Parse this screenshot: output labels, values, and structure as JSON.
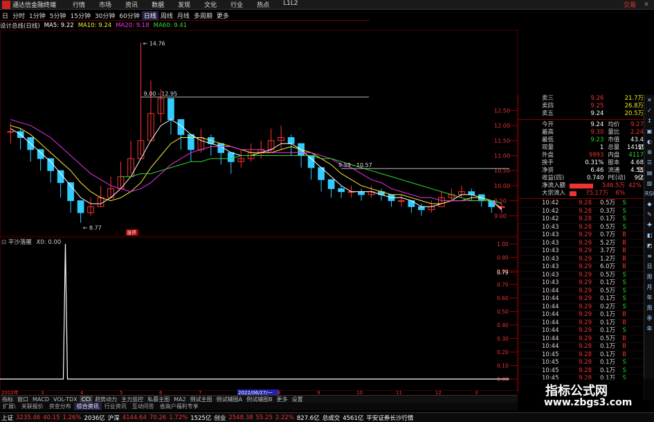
{
  "title_bar": {
    "app_name": "通达信金融终端",
    "menus": [
      "行情",
      "市场",
      "资讯",
      "数据",
      "发现",
      "文化",
      "行业",
      "热点",
      "L1L2"
    ],
    "trade_label": "交易"
  },
  "toolbar": {
    "items": [
      "日",
      "分时",
      "1分钟",
      "5分钟",
      "15分钟",
      "30分钟",
      "60分钟",
      "日线",
      "周线",
      "月线",
      "多周期",
      "更多"
    ],
    "active_index": 7
  },
  "ma_legend": {
    "name": "设计总线(日线)",
    "ma5": "MA5: 9.22",
    "ma10": "MA10: 9.24",
    "ma20": "MA20: 9.18",
    "ma60": "MA60: 9.41"
  },
  "colors": {
    "up": "#ff3333",
    "down": "#33ccff",
    "ma5": "#ffffff",
    "ma10": "#ffee33",
    "ma20": "#ee33ee",
    "ma60": "#33dd33",
    "bg": "#000000",
    "frame": "#880000"
  },
  "price_annotations": {
    "high": "14.76",
    "low": "8.77",
    "range1": "9.00 - 12.95",
    "range2": "9.59 - 10.57",
    "marker1": "涨停"
  },
  "price_axis": [
    "12.50",
    "12.00",
    "11.50",
    "11.00",
    "10.50",
    "10.00",
    "9.50",
    "9.00"
  ],
  "indicator": {
    "name": "平沙落雁",
    "value": "X0: 0.00",
    "axis": [
      "1.00",
      "0.90",
      "0.80",
      "0.79",
      "0.70",
      "0.60",
      "0.50",
      "0.40",
      "0.30",
      "0.20",
      "0.10",
      "0.00"
    ]
  },
  "date_axis": [
    "2022年",
    "3",
    "4",
    "5",
    "6",
    "7",
    "2022/06/27/一",
    "8",
    "9",
    "10",
    "11",
    "12",
    "3"
  ],
  "bottom_tabs": [
    "指标",
    "窗口",
    "MACD",
    "VOL-TDX",
    "CCI",
    "趋势动力",
    "主力监控",
    "私募主图",
    "MA2",
    "例试主图",
    "例试辅图A",
    "例试辅图B",
    "更多",
    "设置"
  ],
  "bottom_tabs_active": 4,
  "bottom_tabs2": [
    "扩展\\",
    "关联报价",
    "资金分布",
    "综合资讯",
    "行业资讯",
    "互动问答",
    "省商户福利专享"
  ],
  "bottom_tabs2_active": 3,
  "quote": {
    "rows": [
      {
        "l1": "卖三",
        "v1": "9.26",
        "c1": "red",
        "v1b": "21.7万",
        "c1b": "yellow"
      },
      {
        "l1": "卖四",
        "v1": "9.25",
        "c1": "red",
        "v1b": "26.8万",
        "c1b": "yellow"
      },
      {
        "l1": "卖五",
        "v1": "9.24",
        "c1": "white",
        "v1b": "20.5万",
        "c1b": "yellow"
      }
    ],
    "stats": [
      {
        "l1": "今开",
        "v1": "9.24",
        "c1": "white",
        "l2": "均价",
        "v2": "9.27",
        "c2": "red"
      },
      {
        "l1": "最高",
        "v1": "9.30",
        "c1": "red",
        "l2": "量比",
        "v2": "2.24",
        "c2": "red"
      },
      {
        "l1": "最低",
        "v1": "9.23",
        "c1": "green",
        "l2": "市值",
        "v2": "43.4亿",
        "c2": "white"
      },
      {
        "l1": "现量",
        "v1": "1",
        "c1": "white",
        "l2": "总量",
        "v2": "14110",
        "c2": "white"
      },
      {
        "l1": "外盘",
        "v1": "9993",
        "c1": "red",
        "l2": "内盘",
        "v2": "4117",
        "c2": "green"
      },
      {
        "l1": "换手",
        "v1": "0.31%",
        "c1": "white",
        "l2": "股本",
        "v2": "4.68亿",
        "c2": "white"
      },
      {
        "l1": "净资",
        "v1": "6.46",
        "c1": "white",
        "l2": "流通",
        "v2": "4.55亿",
        "c2": "white"
      },
      {
        "l1": "收益(四)",
        "v1": "0.740",
        "c1": "white",
        "l2": "PE(动)",
        "v2": "9.7",
        "c2": "white"
      }
    ],
    "flow": [
      {
        "l": "净流入额",
        "v": "546.5万",
        "p": "42%"
      },
      {
        "l": "大宗流入",
        "v": "75.17万",
        "p": "6%"
      }
    ]
  },
  "ticks": [
    {
      "t": "10:42",
      "p": "9.28",
      "v": "0.5万",
      "s": "S"
    },
    {
      "t": "10:42",
      "p": "9.28",
      "v": "0.3万",
      "s": "S"
    },
    {
      "t": "10:42",
      "p": "9.28",
      "v": "0.1万",
      "s": "S"
    },
    {
      "t": "10:43",
      "p": "9.28",
      "v": "0.5万",
      "s": "S"
    },
    {
      "t": "10:43",
      "p": "9.29",
      "v": "0.7万",
      "s": "B"
    },
    {
      "t": "10:43",
      "p": "9.29",
      "v": "5.2万",
      "s": "B"
    },
    {
      "t": "10:43",
      "p": "9.29",
      "v": "3.7万",
      "s": "B"
    },
    {
      "t": "10:43",
      "p": "9.29",
      "v": "1.2万",
      "s": "B"
    },
    {
      "t": "10:43",
      "p": "9.29",
      "v": "6.0万",
      "s": "B"
    },
    {
      "t": "10:43",
      "p": "9.29",
      "v": "0.5万",
      "s": "S"
    },
    {
      "t": "10:43",
      "p": "9.29",
      "v": "0.1万",
      "s": "S"
    },
    {
      "t": "10:44",
      "p": "9.29",
      "v": "0.5万",
      "s": "S"
    },
    {
      "t": "10:44",
      "p": "9.29",
      "v": "0.1万",
      "s": "S"
    },
    {
      "t": "10:44",
      "p": "9.29",
      "v": "0.2万",
      "s": "S"
    },
    {
      "t": "10:44",
      "p": "9.29",
      "v": "0.1万",
      "s": "B"
    },
    {
      "t": "10:44",
      "p": "9.29",
      "v": "0.1万",
      "s": "B"
    },
    {
      "t": "10:44",
      "p": "9.29",
      "v": "0.1万",
      "s": "S"
    },
    {
      "t": "10:44",
      "p": "9.29",
      "v": "0.5万",
      "s": "B"
    },
    {
      "t": "10:44",
      "p": "9.28",
      "v": "0.1万",
      "s": "B"
    },
    {
      "t": "10:45",
      "p": "9.28",
      "v": "0.1万",
      "s": "B"
    },
    {
      "t": "10:45",
      "p": "9.28",
      "v": "0.1万",
      "s": "S"
    },
    {
      "t": "10:45",
      "p": "9.28",
      "v": "0.1万",
      "s": "S"
    },
    {
      "t": "10:45",
      "p": "9.28",
      "v": "0.1万",
      "s": "S"
    }
  ],
  "side_strip": [
    "✕",
    "✓",
    "↕",
    "▣",
    "◐",
    "⊞",
    "☰",
    "▤",
    "▥",
    "RSI",
    "◆",
    "✎",
    "✚",
    "◧",
    "◩",
    "≡",
    "日",
    "周",
    "月",
    "年",
    "周",
    "季",
    "年"
  ],
  "status_bar": {
    "items": [
      {
        "label": "上证",
        "value": "3235.46",
        "change": "40.15",
        "pct": "1.26%",
        "amount": "2036亿"
      },
      {
        "label": "沪深",
        "value": "4144.64",
        "change": "70.26",
        "pct": "1.72%",
        "amount": "1525亿"
      },
      {
        "label": "创业",
        "value": "2548.38",
        "change": "55.25",
        "pct": "2.22%",
        "amount": "827.6亿"
      }
    ],
    "total_label": "总成交",
    "total_value": "4561亿",
    "news": "平安证券长沙行情"
  },
  "watermark": {
    "title": "指标公式网",
    "url": "www.zbgs3.com"
  },
  "chart_data": {
    "type": "candlestick",
    "title": "设计总线(日线)",
    "xlabel": "",
    "ylabel": "",
    "ylim": [
      8.5,
      15.0
    ],
    "x": [
      "2022-01-04",
      "2022-01-11",
      "2022-01-18",
      "2022-01-25",
      "2022-02-08",
      "2022-02-15",
      "2022-02-22",
      "2022-03-01",
      "2022-03-08",
      "2022-03-15",
      "2022-03-22",
      "2022-03-29",
      "2022-04-06",
      "2022-04-13",
      "2022-04-20",
      "2022-04-27",
      "2022-05-06",
      "2022-05-13",
      "2022-05-20",
      "2022-05-27",
      "2022-06-03",
      "2022-06-10",
      "2022-06-17",
      "2022-06-27",
      "2022-07-04",
      "2022-07-11",
      "2022-07-18",
      "2022-07-25",
      "2022-08-01",
      "2022-08-08",
      "2022-08-15",
      "2022-08-22",
      "2022-08-29",
      "2022-09-05",
      "2022-09-13",
      "2022-09-20",
      "2022-09-27",
      "2022-10-10",
      "2022-10-17",
      "2022-10-24",
      "2022-10-31",
      "2022-11-07",
      "2022-11-14",
      "2022-11-21",
      "2022-11-28",
      "2022-12-05",
      "2022-12-12",
      "2022-12-19",
      "2022-12-26",
      "2023-01-03"
    ],
    "series": [
      {
        "name": "K",
        "close": [
          11.8,
          11.6,
          11.2,
          10.9,
          10.5,
          10.1,
          9.5,
          9.1,
          9.3,
          9.6,
          9.9,
          10.3,
          10.9,
          11.5,
          12.4,
          12.9,
          12.2,
          11.7,
          11.2,
          11.6,
          11.4,
          11.1,
          10.8,
          10.9,
          11.1,
          11.2,
          11.5,
          11.6,
          11.4,
          11.0,
          10.6,
          10.2,
          9.9,
          9.8,
          9.8,
          9.7,
          9.8,
          9.7,
          9.5,
          9.5,
          9.3,
          9.2,
          9.3,
          9.6,
          9.7,
          9.8,
          9.7,
          9.5,
          9.3,
          9.3
        ],
        "high": [
          12.1,
          11.9,
          11.5,
          11.2,
          10.8,
          10.4,
          9.8,
          9.3,
          9.6,
          10.0,
          10.3,
          10.8,
          11.5,
          14.76,
          13.5,
          13.2,
          12.6,
          12.0,
          11.6,
          11.9,
          11.7,
          11.4,
          11.1,
          11.2,
          11.4,
          11.5,
          11.9,
          12.0,
          11.7,
          11.3,
          10.9,
          10.5,
          10.1,
          10.0,
          10.0,
          9.9,
          10.0,
          9.9,
          9.7,
          9.7,
          9.5,
          9.4,
          9.5,
          9.8,
          9.9,
          10.0,
          9.9,
          9.7,
          9.5,
          9.4
        ],
        "low": [
          11.4,
          11.2,
          10.8,
          10.5,
          10.1,
          9.6,
          9.1,
          8.77,
          9.0,
          9.3,
          9.6,
          9.9,
          10.4,
          11.0,
          11.6,
          12.1,
          11.7,
          11.2,
          10.8,
          11.1,
          11.0,
          10.7,
          10.4,
          10.6,
          10.8,
          10.9,
          11.1,
          11.2,
          11.0,
          10.6,
          10.2,
          9.8,
          9.6,
          9.59,
          9.6,
          9.5,
          9.6,
          9.5,
          9.3,
          9.3,
          9.1,
          9.0,
          9.1,
          9.4,
          9.5,
          9.6,
          9.5,
          9.3,
          9.1,
          9.1
        ]
      },
      {
        "name": "MA5",
        "values": [
          11.9,
          11.7,
          11.4,
          11.1,
          10.8,
          10.4,
          10.0,
          9.6,
          9.4,
          9.4,
          9.6,
          9.9,
          10.3,
          10.9,
          11.5,
          12.0,
          12.2,
          12.0,
          11.7,
          11.5,
          11.4,
          11.3,
          11.1,
          11.0,
          11.0,
          11.1,
          11.2,
          11.4,
          11.4,
          11.2,
          10.9,
          10.6,
          10.3,
          10.0,
          9.8,
          9.8,
          9.8,
          9.7,
          9.6,
          9.6,
          9.5,
          9.3,
          9.3,
          9.4,
          9.5,
          9.7,
          9.7,
          9.6,
          9.5,
          9.22
        ]
      },
      {
        "name": "MA10",
        "values": [
          12.0,
          11.9,
          11.7,
          11.4,
          11.1,
          10.8,
          10.5,
          10.1,
          9.8,
          9.6,
          9.5,
          9.6,
          9.8,
          10.1,
          10.6,
          11.0,
          11.4,
          11.6,
          11.6,
          11.6,
          11.5,
          11.4,
          11.3,
          11.2,
          11.1,
          11.1,
          11.1,
          11.2,
          11.3,
          11.2,
          11.1,
          10.9,
          10.7,
          10.4,
          10.2,
          10.0,
          9.9,
          9.8,
          9.7,
          9.7,
          9.6,
          9.5,
          9.4,
          9.4,
          9.5,
          9.5,
          9.6,
          9.6,
          9.5,
          9.24
        ]
      },
      {
        "name": "MA20",
        "values": [
          12.2,
          12.1,
          12.0,
          11.8,
          11.6,
          11.3,
          11.0,
          10.7,
          10.4,
          10.2,
          10.0,
          9.9,
          9.8,
          9.9,
          10.1,
          10.4,
          10.7,
          10.9,
          11.1,
          11.2,
          11.3,
          11.3,
          11.3,
          11.2,
          11.2,
          11.2,
          11.1,
          11.1,
          11.1,
          11.1,
          11.1,
          11.0,
          10.9,
          10.7,
          10.6,
          10.4,
          10.2,
          10.1,
          9.9,
          9.8,
          9.7,
          9.6,
          9.6,
          9.5,
          9.5,
          9.5,
          9.5,
          9.5,
          9.5,
          9.18
        ]
      },
      {
        "name": "MA60",
        "values": [
          null,
          null,
          null,
          null,
          null,
          null,
          null,
          null,
          null,
          null,
          null,
          10.3,
          10.3,
          10.4,
          10.4,
          10.5,
          10.6,
          10.7,
          10.8,
          10.8,
          10.9,
          10.9,
          10.9,
          11.0,
          11.0,
          11.0,
          11.0,
          11.0,
          11.0,
          11.0,
          11.0,
          10.9,
          10.9,
          10.8,
          10.7,
          10.6,
          10.5,
          10.4,
          10.3,
          10.2,
          10.1,
          10.0,
          9.9,
          9.8,
          9.7,
          9.6,
          9.5,
          9.5,
          9.5,
          9.41
        ]
      }
    ],
    "indicator_series": {
      "name": "X0",
      "spike_index": 13,
      "values_note": "0.00"
    }
  }
}
